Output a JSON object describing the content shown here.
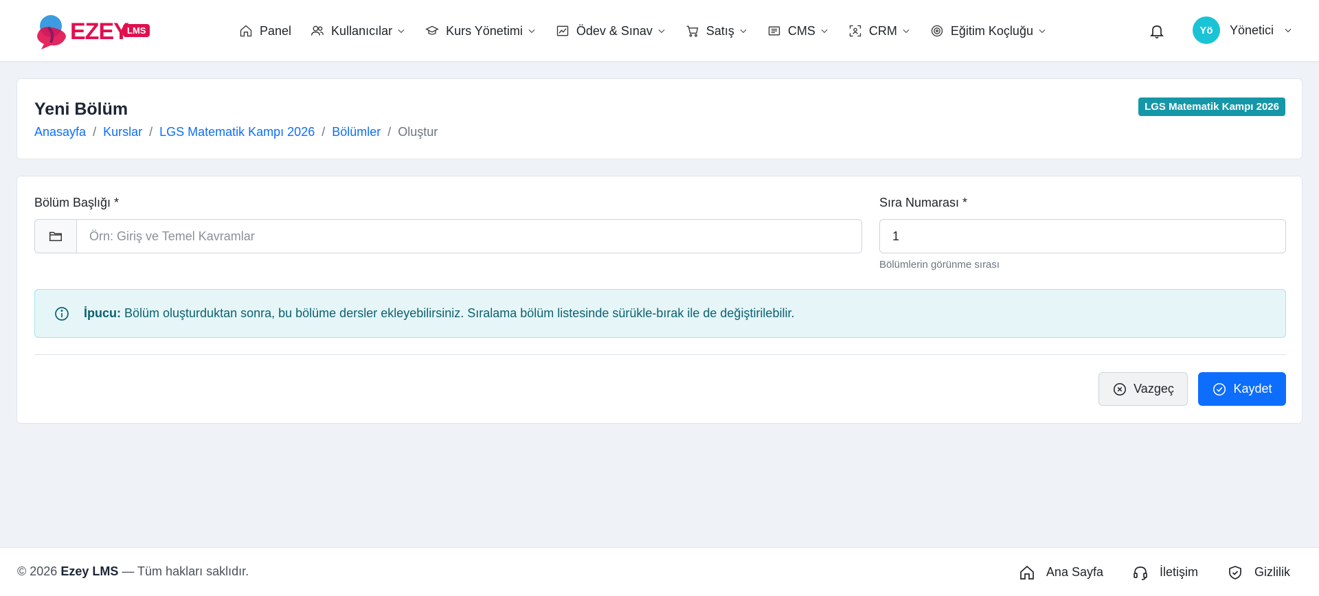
{
  "brand": {
    "name": "EZEY",
    "badge": "LMS"
  },
  "nav": [
    {
      "label": "Panel",
      "icon": "home-icon",
      "dropdown": false
    },
    {
      "label": "Kullanıcılar",
      "icon": "users-icon",
      "dropdown": true
    },
    {
      "label": "Kurs Yönetimi",
      "icon": "graduation-cap-icon",
      "dropdown": true
    },
    {
      "label": "Ödev & Sınav",
      "icon": "image-chart-icon",
      "dropdown": true
    },
    {
      "label": "Satış",
      "icon": "cart-icon",
      "dropdown": true
    },
    {
      "label": "CMS",
      "icon": "newspaper-icon",
      "dropdown": true
    },
    {
      "label": "CRM",
      "icon": "scan-person-icon",
      "dropdown": true
    },
    {
      "label": "Eğitim Koçluğu",
      "icon": "target-icon",
      "dropdown": true
    }
  ],
  "user": {
    "initials": "Yö",
    "name": "Yönetici"
  },
  "page": {
    "title": "Yeni Bölüm",
    "course_badge": "LGS Matematik Kampı 2026",
    "breadcrumb": [
      "Anasayfa",
      "Kurslar",
      "LGS Matematik Kampı 2026",
      "Bölümler"
    ],
    "breadcrumb_current": "Oluştur",
    "breadcrumb_sep": "/"
  },
  "form": {
    "title_label": "Bölüm Başlığı *",
    "title_placeholder": "Örn: Giriş ve Temel Kavramlar",
    "title_value": "",
    "order_label": "Sıra Numarası *",
    "order_value": "1",
    "order_help": "Bölümlerin görünme sırası",
    "tip_label": "İpucu:",
    "tip_text": "Bölüm oluşturduktan sonra, bu bölüme dersler ekleyebilirsiniz. Sıralama bölüm listesinde sürükle-bırak ile de değiştirilebilir.",
    "cancel_label": "Vazgeç",
    "save_label": "Kaydet"
  },
  "footer": {
    "copy_prefix": "© 2026",
    "brand": "Ezey LMS",
    "copy_suffix": "— Tüm hakları saklıdır.",
    "links": [
      {
        "label": "Ana Sayfa",
        "icon": "home-icon"
      },
      {
        "label": "İletişim",
        "icon": "headset-icon"
      },
      {
        "label": "Gizlilik",
        "icon": "shield-check-icon"
      }
    ]
  },
  "colors": {
    "primary": "#0d6efd",
    "brand": "#e0104f",
    "badge": "#1597a8",
    "avatar": "#1bc3d6",
    "alert_bg": "#e6f6f8"
  }
}
